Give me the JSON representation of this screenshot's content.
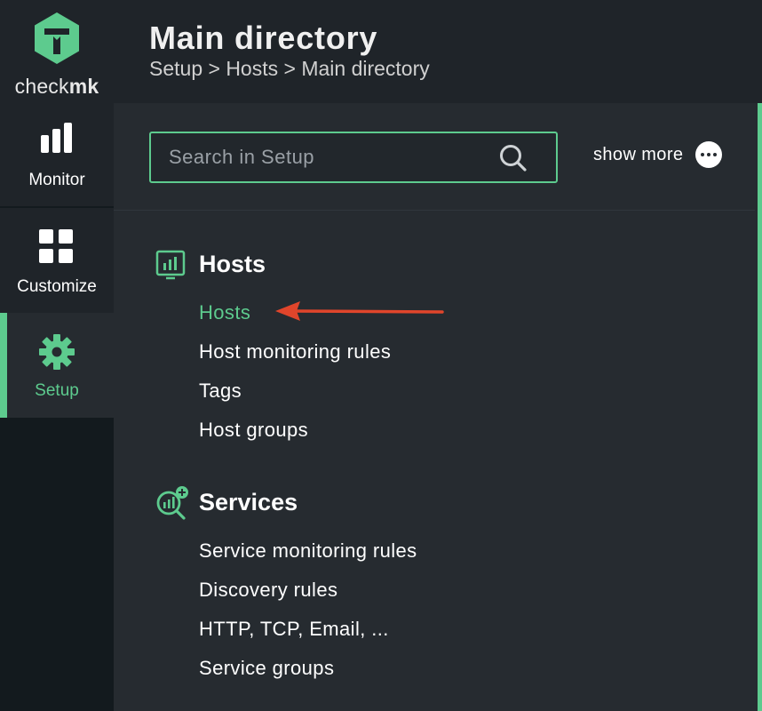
{
  "logo": {
    "text_main": "check",
    "text_bold": "mk"
  },
  "nav": [
    {
      "id": "monitor",
      "label": "Monitor"
    },
    {
      "id": "customize",
      "label": "Customize"
    },
    {
      "id": "setup",
      "label": "Setup"
    }
  ],
  "header": {
    "title": "Main directory",
    "breadcrumb": "Setup > Hosts > Main directory"
  },
  "search": {
    "placeholder": "Search in Setup",
    "value": ""
  },
  "show_more": {
    "label": "show more"
  },
  "sections": [
    {
      "title": "Hosts",
      "icon": "host-icon",
      "items": [
        "Hosts",
        "Host monitoring rules",
        "Tags",
        "Host groups"
      ],
      "active": "Hosts"
    },
    {
      "title": "Services",
      "icon": "services-search-icon",
      "items": [
        "Service monitoring rules",
        "Discovery rules",
        "HTTP, TCP, Email, ...",
        "Service groups"
      ]
    }
  ],
  "colors": {
    "accent": "#5dcb8e",
    "background": "#262b30",
    "header_bg": "#1f2429",
    "nav_bg": "#131a1e",
    "annotation_arrow": "#e0452b"
  }
}
